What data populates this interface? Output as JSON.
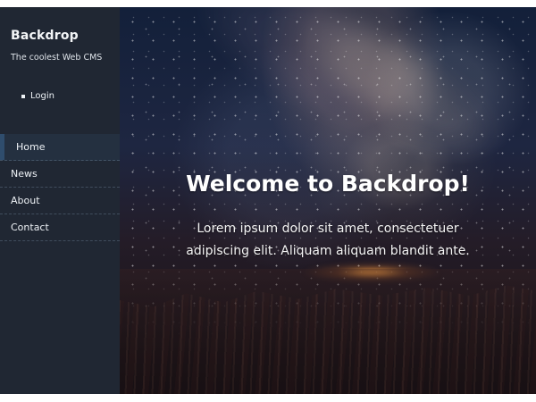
{
  "site": {
    "name": "Backdrop",
    "slogan": "The coolest Web CMS"
  },
  "user_menu": {
    "login_label": "Login"
  },
  "main_navigation": {
    "items": [
      {
        "label": "Home",
        "active": true
      },
      {
        "label": "News",
        "active": false
      },
      {
        "label": "About",
        "active": false
      },
      {
        "label": "Contact",
        "active": false
      }
    ]
  },
  "hero": {
    "title": "Welcome to Backdrop!",
    "body_lines": [
      "Lorem ipsum dolor sit amet, consectetuer",
      "adipiscing elit. Aliquam aliquam blandit ante."
    ]
  }
}
